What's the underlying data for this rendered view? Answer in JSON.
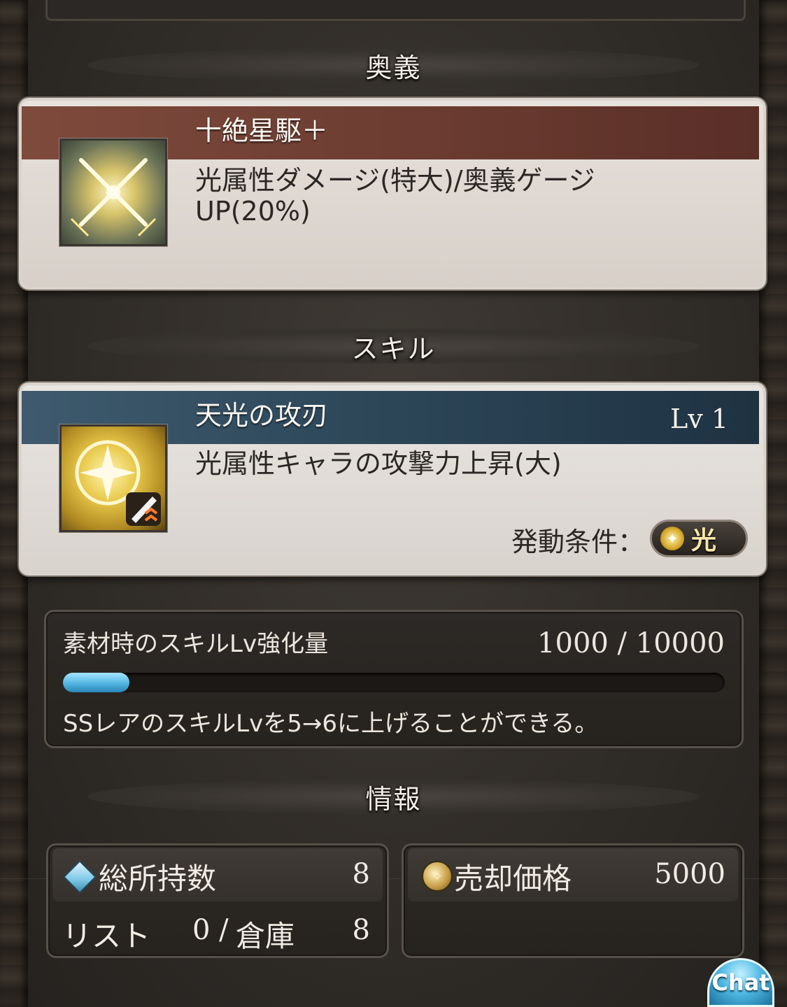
{
  "sections": {
    "ougi": "奥義",
    "skill": "スキル",
    "info": "情報"
  },
  "ougi_card": {
    "name": "十絶星駆＋",
    "description": "光属性ダメージ(特大)/奥義ゲージUP(20%)",
    "icon": "crossed-swords-icon"
  },
  "skill_card": {
    "name": "天光の攻刃",
    "level": "Lv 1",
    "description": "光属性キャラの攻撃力上昇(大)",
    "condition_label": "発動条件：",
    "condition_element": "光",
    "icon": "light-star-sword-icon"
  },
  "skill_lv_panel": {
    "label": "素材時のスキルLv強化量",
    "count": "1000 / 10000",
    "progress": 0.1,
    "note": "SSレアのスキルLvを5→6に上げることができる。"
  },
  "info": {
    "owned_label": "総所持数",
    "owned_value": "8",
    "list_label": "リスト",
    "list_value": "0 /",
    "storage_label": "倉庫",
    "storage_value": "8",
    "sell_label": "売却価格",
    "sell_value": "5000"
  },
  "chat_label": "Chat",
  "colors": {
    "ougi_banner": "#7e4a3c",
    "skill_banner": "#2f4a5c",
    "progress_fill": "#53b5e0"
  }
}
